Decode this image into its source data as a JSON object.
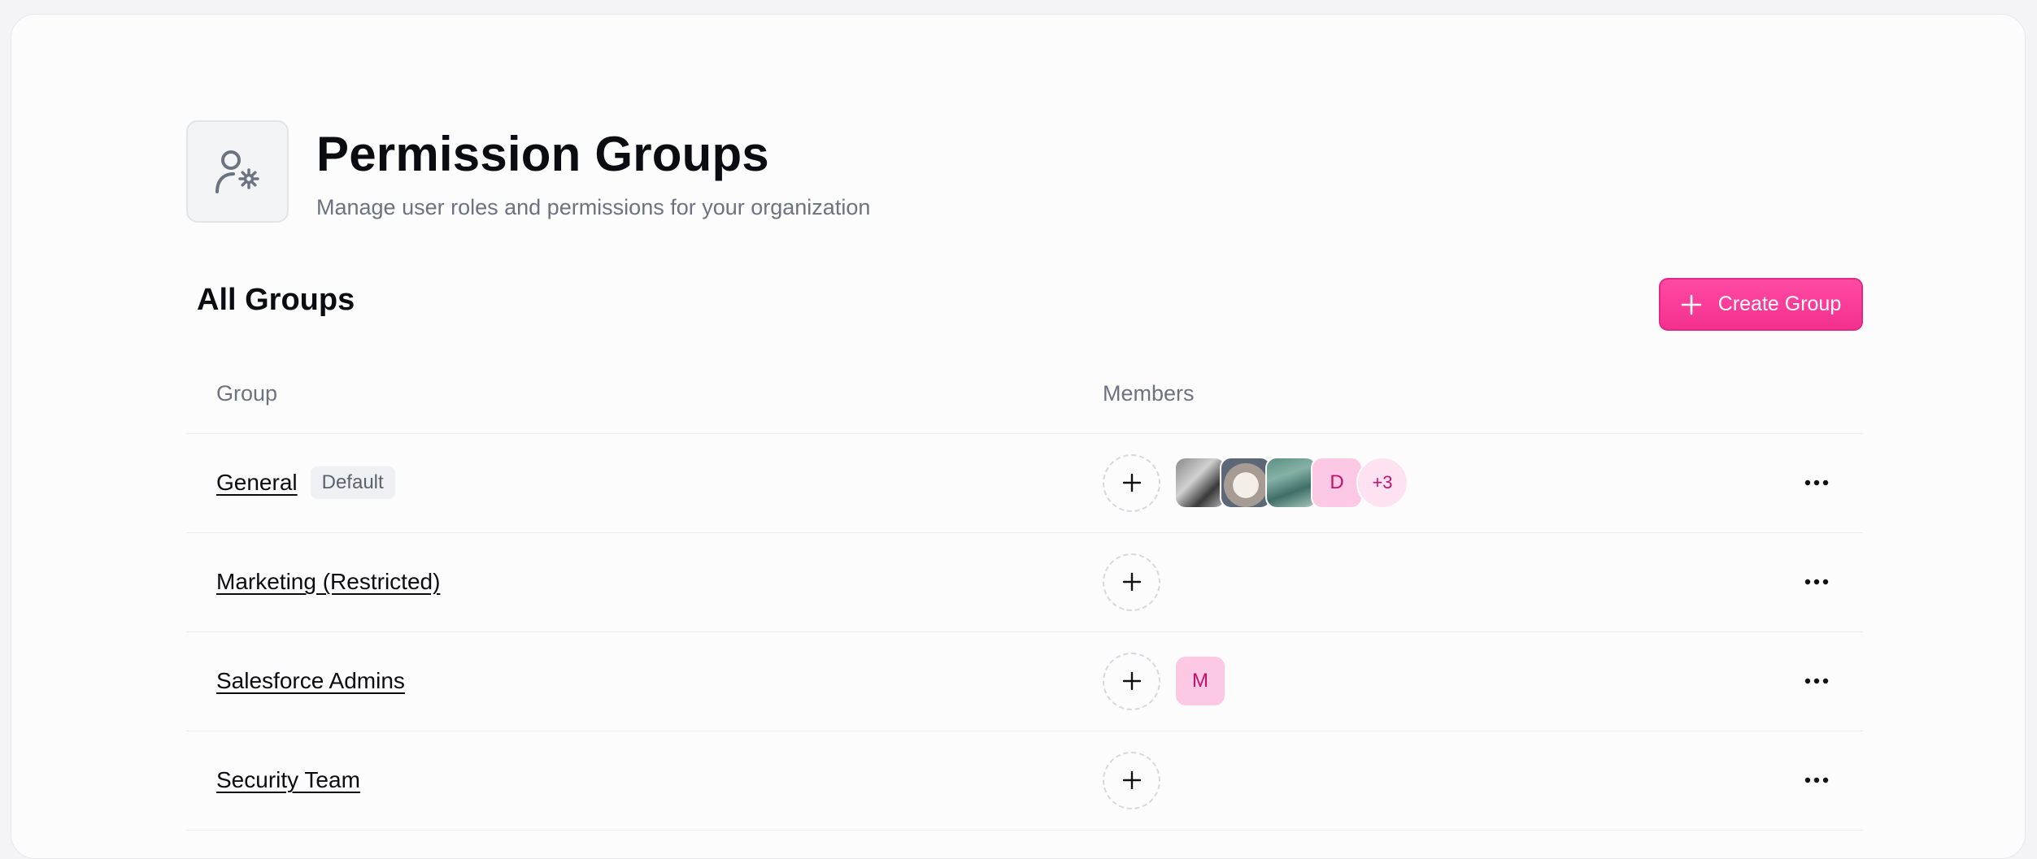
{
  "header": {
    "title": "Permission Groups",
    "subtitle": "Manage user roles and permissions for your organization",
    "icon": "user-gear-icon"
  },
  "section": {
    "title": "All Groups",
    "create_button_label": "Create Group"
  },
  "table": {
    "columns": [
      "Group",
      "Members"
    ],
    "rows": [
      {
        "name": "General",
        "badge": "Default",
        "members": [
          {
            "type": "photo",
            "label": "member photo 1"
          },
          {
            "type": "photo",
            "label": "member photo 2"
          },
          {
            "type": "photo",
            "label": "member photo 3"
          },
          {
            "type": "initial",
            "label": "D"
          }
        ],
        "more_count": "+3"
      },
      {
        "name": "Marketing (Restricted)",
        "badge": null,
        "members": []
      },
      {
        "name": "Salesforce Admins",
        "badge": null,
        "members": [
          {
            "type": "initial",
            "label": "M"
          }
        ]
      },
      {
        "name": "Security Team",
        "badge": null,
        "members": []
      }
    ]
  },
  "colors": {
    "accent": "#f5308f",
    "initial_avatar_bg": "#fcc8e4",
    "initial_avatar_text": "#c0126c"
  }
}
